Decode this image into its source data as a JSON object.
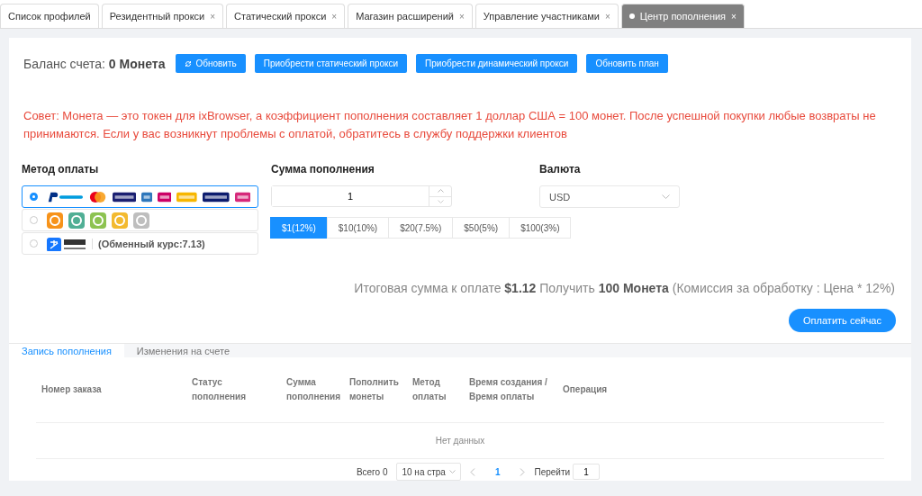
{
  "tabs": [
    {
      "label": "Список профилей",
      "selected": false
    },
    {
      "label": "Резидентный прокси",
      "selected": false,
      "close": "×"
    },
    {
      "label": "Статический прокси",
      "selected": false,
      "close": "×"
    },
    {
      "label": "Магазин расширений",
      "selected": false,
      "close": "×"
    },
    {
      "label": "Управление участниками",
      "selected": false,
      "close": "×"
    },
    {
      "label": "Центр пополнения",
      "selected": true,
      "close": "×"
    }
  ],
  "balance": {
    "label": "Баланс счета:",
    "value": "0 Монета"
  },
  "actions": [
    "Обновить",
    "Приобрести статический прокси",
    "Приобрести динамический прокси",
    "Обновить план"
  ],
  "notice": "Совет: Монета — это токен для ixBrowser, а коэффициент пополнения составляет 1 доллар США = 100 монет. После успешной покупки любые возвраты не принимаются. Если у вас возникнут проблемы с оплатой, обратитесь в службу поддержки клиентов",
  "payment": {
    "label": "Метод оплаты",
    "methods": [
      {
        "kind": "cards",
        "selected": true
      },
      {
        "kind": "crypto",
        "selected": false
      },
      {
        "kind": "alipay",
        "selected": false,
        "note": "(Обменный курс:7.13)"
      }
    ]
  },
  "amount": {
    "label": "Сумма пополнения",
    "value": "1",
    "presets": [
      {
        "label": "$1(12%)",
        "selected": true
      },
      {
        "label": "$10(10%)",
        "selected": false
      },
      {
        "label": "$20(7.5%)",
        "selected": false
      },
      {
        "label": "$50(5%)",
        "selected": false
      },
      {
        "label": "$100(3%)",
        "selected": false
      }
    ]
  },
  "currency": {
    "label": "Валюта",
    "value": "USD"
  },
  "summary": "Итоговая сумма к оплате **$1.12** Получить **100 Монета** (Комиссия за обработку : Цена * 12%)",
  "pay_button": "Оплатить сейчас",
  "record_tabs": [
    {
      "label": "Запись пополнения",
      "selected": true
    },
    {
      "label": "Изменения на счете",
      "selected": false
    }
  ],
  "table": {
    "columns": [
      "Номер заказа",
      "Статус пополнения",
      "Сумма пополнения",
      "Пополнить монеты",
      "Метод оплаты",
      "Время создания / Время оплаты",
      "Операция"
    ],
    "empty": "Нет данных"
  },
  "pagination": {
    "total": "Всего 0",
    "page_size": "10 на стра",
    "page": "1",
    "goto_label": "Перейти",
    "goto_value": "1"
  }
}
